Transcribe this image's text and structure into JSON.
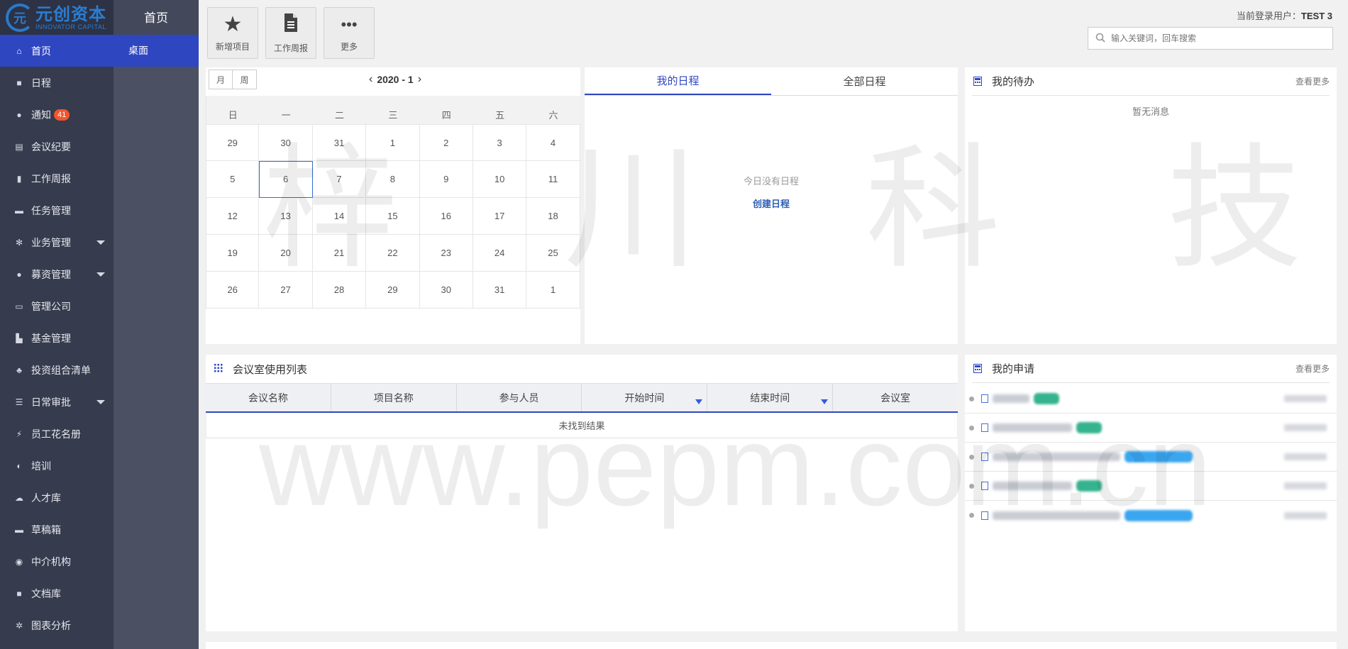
{
  "logo": {
    "cn": "元创资本",
    "en": "INNOVATOR CAPITAL"
  },
  "sidebar": {
    "items": [
      {
        "label": "首页",
        "icon": "home-icon",
        "glyph": "⌂"
      },
      {
        "label": "日程",
        "icon": "calendar-icon",
        "glyph": "■"
      },
      {
        "label": "通知",
        "icon": "chat-bubble-icon",
        "glyph": "●",
        "badge": "41"
      },
      {
        "label": "会议纪要",
        "icon": "clipboard-icon",
        "glyph": "▤"
      },
      {
        "label": "工作周报",
        "icon": "document-icon",
        "glyph": "▮"
      },
      {
        "label": "任务管理",
        "icon": "car-icon",
        "glyph": "▬"
      },
      {
        "label": "业务管理",
        "icon": "asterisk-icon",
        "glyph": "✻"
      },
      {
        "label": "募资管理",
        "icon": "globe-icon",
        "glyph": "●"
      },
      {
        "label": "管理公司",
        "icon": "briefcase-icon",
        "glyph": "▭"
      },
      {
        "label": "基金管理",
        "icon": "bar-chart-icon",
        "glyph": "▙"
      },
      {
        "label": "投资组合清单",
        "icon": "cubes-icon",
        "glyph": "♣"
      },
      {
        "label": "日常审批",
        "icon": "sliders-icon",
        "glyph": "☰"
      },
      {
        "label": "员工花名册",
        "icon": "bolt-icon",
        "glyph": "⚡"
      },
      {
        "label": "培训",
        "icon": "half-circle-icon",
        "glyph": "◐"
      },
      {
        "label": "人才库",
        "icon": "cloud-icon",
        "glyph": "☁"
      },
      {
        "label": "草稿箱",
        "icon": "inbox-icon",
        "glyph": "▬"
      },
      {
        "label": "中介机构",
        "icon": "chrome-icon",
        "glyph": "◉"
      },
      {
        "label": "文档库",
        "icon": "folder-icon",
        "glyph": "■"
      },
      {
        "label": "图表分析",
        "icon": "asterisk-icon",
        "glyph": "✲"
      }
    ]
  },
  "subnav": {
    "title": "首页",
    "item": "桌面"
  },
  "toolbar": {
    "buttons": [
      {
        "label": "新增项目",
        "icon": "star-icon",
        "glyph": "★"
      },
      {
        "label": "工作周报",
        "icon": "document-icon",
        "glyph": "🗎"
      },
      {
        "label": "更多",
        "icon": "more-icon",
        "glyph": "•••"
      }
    ]
  },
  "header": {
    "user_prefix": "当前登录用户：",
    "user_name": "TEST 3",
    "search_placeholder": "输入关键词，回车搜索"
  },
  "calendar": {
    "view_month": "月",
    "view_week": "周",
    "period": "2020 - 1",
    "weekdays": [
      "日",
      "一",
      "二",
      "三",
      "四",
      "五",
      "六"
    ],
    "weeks": [
      [
        "29",
        "30",
        "31",
        "1",
        "2",
        "3",
        "4"
      ],
      [
        "5",
        "6",
        "7",
        "8",
        "9",
        "10",
        "11"
      ],
      [
        "12",
        "13",
        "14",
        "15",
        "16",
        "17",
        "18"
      ],
      [
        "19",
        "20",
        "21",
        "22",
        "23",
        "24",
        "25"
      ],
      [
        "26",
        "27",
        "28",
        "29",
        "30",
        "31",
        "1"
      ]
    ],
    "selected": "6"
  },
  "schedule": {
    "tab_mine": "我的日程",
    "tab_all": "全部日程",
    "empty": "今日没有日程",
    "create": "创建日程"
  },
  "todo": {
    "title": "我的待办",
    "more": "查看更多",
    "empty": "暂无消息"
  },
  "meeting": {
    "title": "会议室使用列表",
    "columns": [
      "会议名称",
      "项目名称",
      "参与人员",
      "开始时间",
      "结束时间",
      "会议室"
    ],
    "empty": "未找到结果"
  },
  "apply": {
    "title": "我的申请",
    "more": "查看更多"
  },
  "watermark": {
    "cn": "梓川科技",
    "url": "www.pepm.com.cn"
  },
  "colors": {
    "accent": "#2f46c1",
    "sidebar": "#363b4d",
    "subnav": "#4b5063",
    "badge": "#f2552c",
    "tag_green": "#35b38e",
    "tag_blue": "#3aa6f0"
  }
}
